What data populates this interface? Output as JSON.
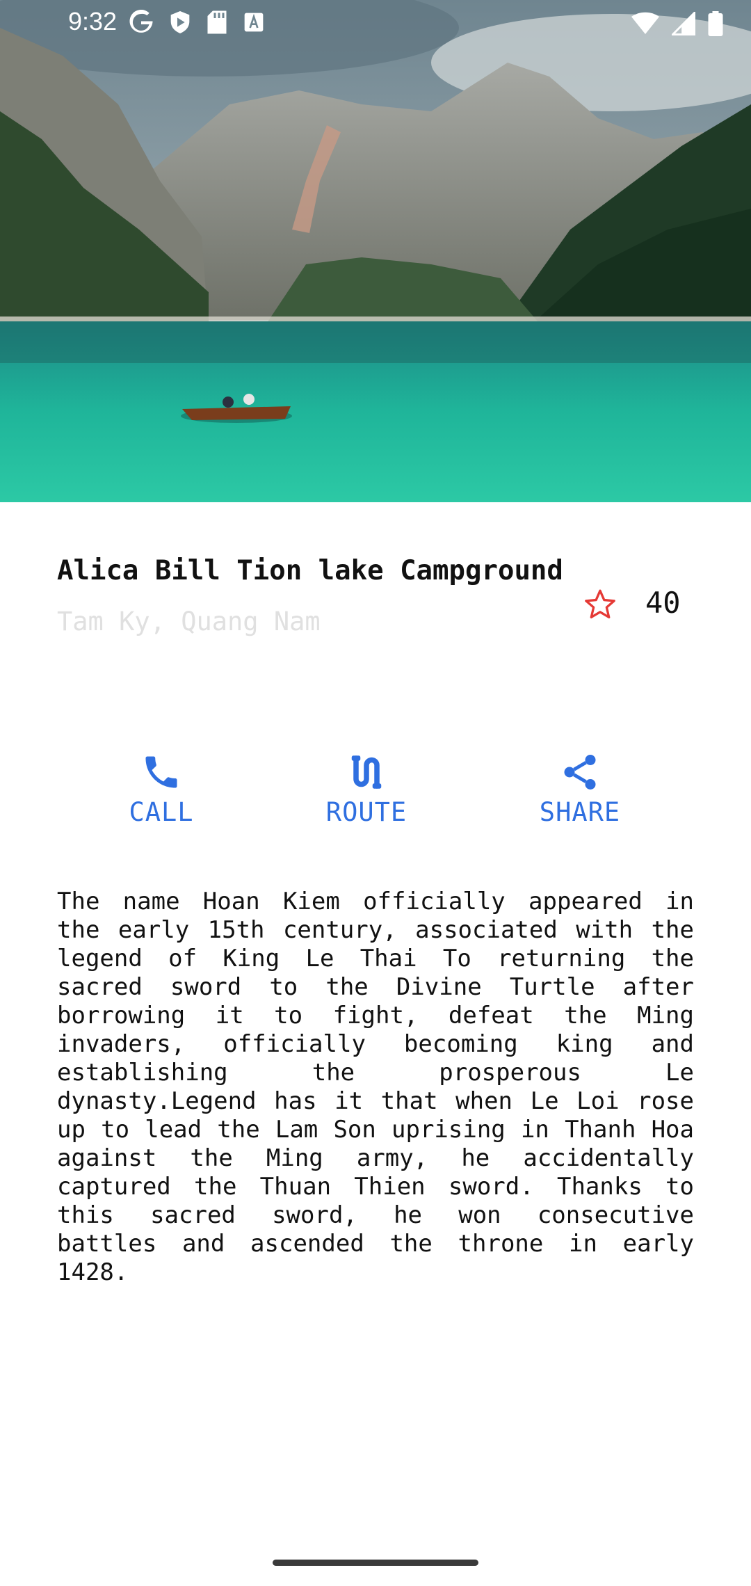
{
  "status_bar": {
    "time": "9:32",
    "left_icons": [
      "google-icon",
      "shield-play-icon",
      "sd-card-icon",
      "a-box-icon"
    ],
    "right_icons": [
      "wifi-icon",
      "signal-icon",
      "battery-icon"
    ]
  },
  "hero": {
    "image": "mountain-lake-with-boat-photo"
  },
  "place": {
    "name": "Alica Bill Tion lake Campground",
    "location": "Tam Ky, Quang Nam",
    "rating": "40",
    "rating_icon": "star-outline-icon"
  },
  "actions": {
    "call": {
      "label": "CALL",
      "icon": "phone-icon"
    },
    "route": {
      "label": "ROUTE",
      "icon": "route-icon"
    },
    "share": {
      "label": "SHARE",
      "icon": "share-icon"
    }
  },
  "description": "The name Hoan Kiem officially appeared in the early 15th century, associated with the legend of King Le Thai To returning the sacred sword to the Divine Turtle after borrowing it to fight, defeat the Ming invaders, officially becoming king and establishing the prosperous Le dynasty.Legend has it that when Le Loi rose up to lead the Lam Son uprising in Thanh Hoa against the Ming army, he accidentally captured the Thuan Thien sword. Thanks to this sacred sword, he won consecutive battles and ascended the throne in early 1428.",
  "colors": {
    "accent": "#2f6fe0",
    "star": "#e53935",
    "subtitle": "#e0e0e0",
    "text": "#111111"
  }
}
